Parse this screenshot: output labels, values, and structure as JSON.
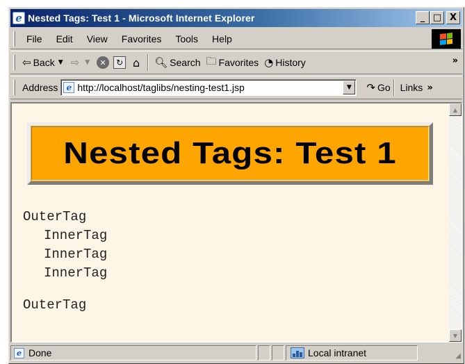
{
  "window": {
    "title": "Nested Tags: Test 1 - Microsoft Internet Explorer",
    "minimize_label": "_",
    "maximize_label": "□",
    "close_label": "X"
  },
  "menubar": {
    "items": [
      "File",
      "Edit",
      "View",
      "Favorites",
      "Tools",
      "Help"
    ]
  },
  "toolbar": {
    "back_label": "Back",
    "search_label": "Search",
    "favorites_label": "Favorites",
    "history_label": "History"
  },
  "address": {
    "label": "Address",
    "url": "http://localhost/taglibs/nesting-test1.jsp",
    "go_label": "Go",
    "links_label": "Links"
  },
  "page": {
    "heading": "Nested Tags: Test 1",
    "heading_color": "#ffa500",
    "background_color": "#fdf5e6",
    "outer_tag_1": "OuterTag",
    "inner_tags": [
      "InnerTag",
      "InnerTag",
      "InnerTag"
    ],
    "outer_tag_2": "OuterTag"
  },
  "status": {
    "text": "Done",
    "zone": "Local intranet"
  }
}
